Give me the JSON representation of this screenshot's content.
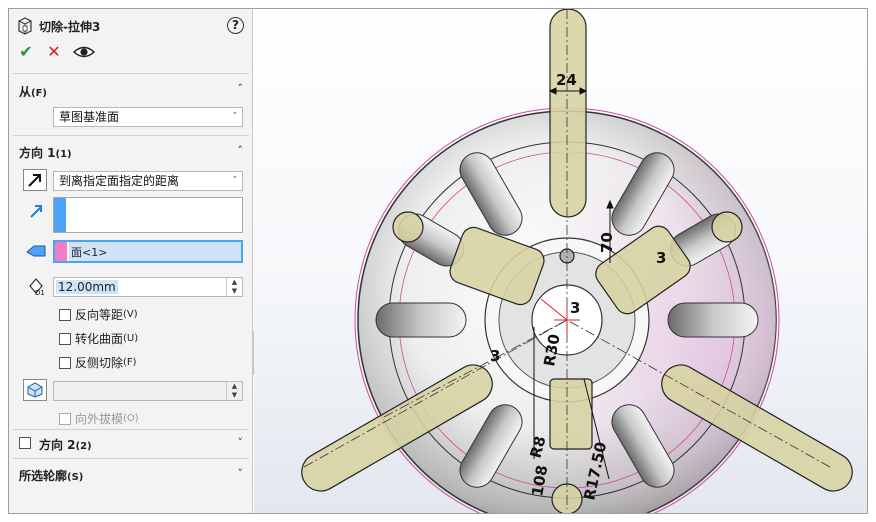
{
  "feature": {
    "title": "切除-拉伸3",
    "help": "?"
  },
  "actions": {
    "ok": "✔",
    "cancel": "✕",
    "preview": "eye-icon"
  },
  "from": {
    "header": "从",
    "shortcut": "(F)",
    "value": "草图基准面"
  },
  "direction1": {
    "header": "方向 1",
    "shortcut": "(1)",
    "end_condition": "到离指定面指定的距离",
    "face_ref": "面<1>",
    "distance": "12.00mm",
    "distance_prefix": "D1",
    "options": [
      {
        "label": "反向等距",
        "shortcut": "(V)",
        "checked": false,
        "enabled": true
      },
      {
        "label": "转化曲面",
        "shortcut": "(U)",
        "checked": false,
        "enabled": true
      },
      {
        "label": "反侧切除",
        "shortcut": "(F)",
        "checked": false,
        "enabled": true
      }
    ],
    "draft": {
      "label": "向外拔模",
      "shortcut": "(O)",
      "checked": false,
      "enabled": false
    }
  },
  "direction2": {
    "header": "方向 2",
    "shortcut": "(2)",
    "checked": false
  },
  "contours": {
    "header": "所选轮廓",
    "shortcut": "(S)"
  },
  "sketch": {
    "dimensions": [
      "24",
      "70",
      "3",
      "3",
      "3",
      "R30",
      "R8",
      "108",
      "R17.50"
    ]
  },
  "colors": {
    "slot_fill": "#d7d3a2",
    "slot_stroke": "#6b6640",
    "highlight_blue": "#4da3f5",
    "highlight_pink": "#f07fc6",
    "selection_bg": "#cfe3f8",
    "accept_green": "#1a9a2a",
    "cancel_red": "#d42020",
    "edge_magenta": "#d24aa0"
  }
}
